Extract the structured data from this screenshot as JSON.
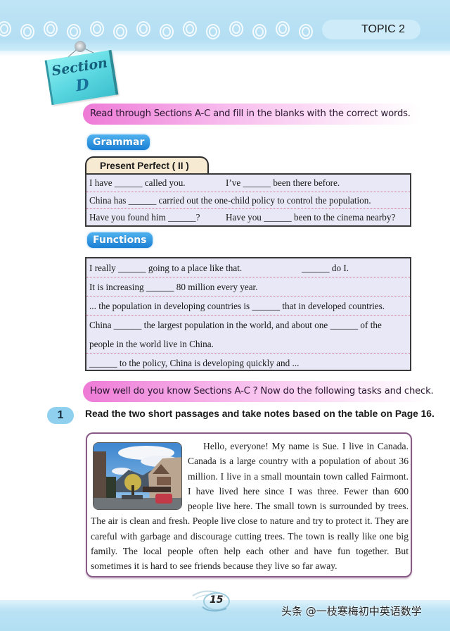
{
  "header": {
    "topic_label": "TOPIC 2",
    "section_title": "Section",
    "section_letter": "D"
  },
  "instructions": {
    "review": "Read through Sections A-C and fill in the blanks with the correct words.",
    "tasks": "How well do you know Sections A-C ? Now do the following tasks and check."
  },
  "grammar": {
    "tag": "Grammar",
    "table_title": "Present Perfect ( II )",
    "rows": [
      {
        "a": "I have ______ called you.",
        "b": "I’ve ______ been there before."
      },
      {
        "a": "China has ______ carried out the one-child policy to control the population.",
        "b": ""
      },
      {
        "a": "Have you found him ______?",
        "b": "Have you ______ been to the cinema nearby?"
      }
    ]
  },
  "functions": {
    "tag": "Functions",
    "rows": [
      {
        "a": "I really ______ going to a place like that.",
        "b": "______ do I."
      },
      {
        "a": "It is increasing ______ 80 million every year.",
        "b": ""
      },
      {
        "a": "... the population in developing countries is ______ that in developed countries.",
        "b": ""
      },
      {
        "a": "China ______ the largest population in the world, and about one ______ of the",
        "b": "people in the world live in China."
      },
      {
        "a": "______ to the policy, China is developing quickly and ...",
        "b": ""
      }
    ]
  },
  "task": {
    "number": "1",
    "text": "Read the two short passages and take notes based on the table on Page 16."
  },
  "passage": {
    "image_alt": "town-street-photo",
    "text": "Hello, everyone! My name is Sue. I live in Canada. Canada is a large country with a population of about 36 million. I live in a small mountain town called Fairmont. I have lived here since I was three. Fewer than 600 people live here. The small town is surrounded by trees. The air is clean and fresh. People live close to nature and try to protect it. They are careful with garbage and discourage cutting trees. The town is really like one big family. The local people often help each other and have fun together. But sometimes it is hard to see friends because they live so far away."
  },
  "footer": {
    "page_number": "15",
    "watermark": "头条 @一枝寒梅初中英语数学"
  },
  "colors": {
    "band_blue": "#b4def3",
    "pink_accent": "#ee7ad6",
    "tag_blue": "#1a7fd4",
    "table_bg": "#e8e8f6",
    "passage_border": "#8a5a86"
  }
}
